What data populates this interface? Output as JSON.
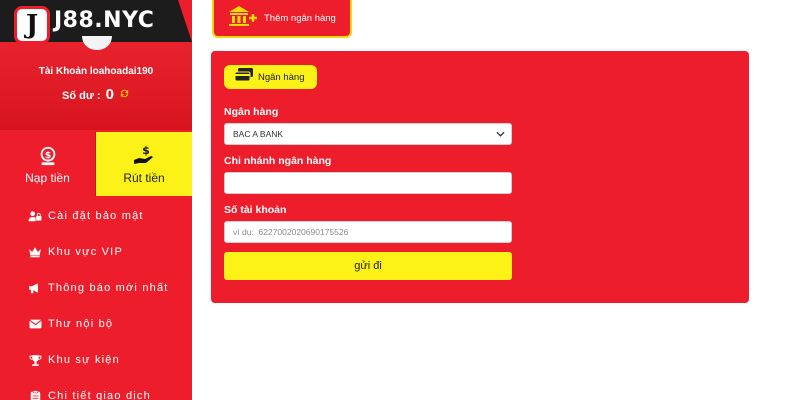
{
  "brand": {
    "logo_letter": "J",
    "name": "J88.NYC"
  },
  "account": {
    "label": "Tài Khoản loahoadai190",
    "balance_label": "Số dư :",
    "balance_value": "0"
  },
  "tabs": [
    {
      "label": "Nạp tiền",
      "icon": "money-bag-icon",
      "active": false
    },
    {
      "label": "Rút tiền",
      "icon": "hand-dollar-icon",
      "active": true
    }
  ],
  "menu": [
    {
      "label": "Cài đặt bảo mật",
      "icon": "user-lock-icon"
    },
    {
      "label": "Khu vực VIP",
      "icon": "crown-icon"
    },
    {
      "label": "Thông báo mới nhất",
      "icon": "megaphone-icon"
    },
    {
      "label": "Thư nội bộ",
      "icon": "envelope-icon"
    },
    {
      "label": "Khu sự kiện",
      "icon": "trophy-icon"
    },
    {
      "label": "Chi tiết giao dịch",
      "icon": "clipboard-icon"
    }
  ],
  "add_bank": {
    "label": "Thêm ngân hàng",
    "icon": "bank-plus-icon"
  },
  "form": {
    "chip_label": "Ngân hàng",
    "bank": {
      "label": "Ngân hàng",
      "value": "BAC A BANK"
    },
    "branch": {
      "label": "Chi nhánh ngân hàng",
      "value": ""
    },
    "account_number": {
      "label": "Số tài khoản",
      "placeholder": "ví dụ:  6227002020690175526"
    },
    "submit_label": "gửi đi"
  },
  "colors": {
    "primary_red": "#ee1d2c",
    "accent_yellow": "#fdf217",
    "logo_dark": "#1c1c1c"
  }
}
